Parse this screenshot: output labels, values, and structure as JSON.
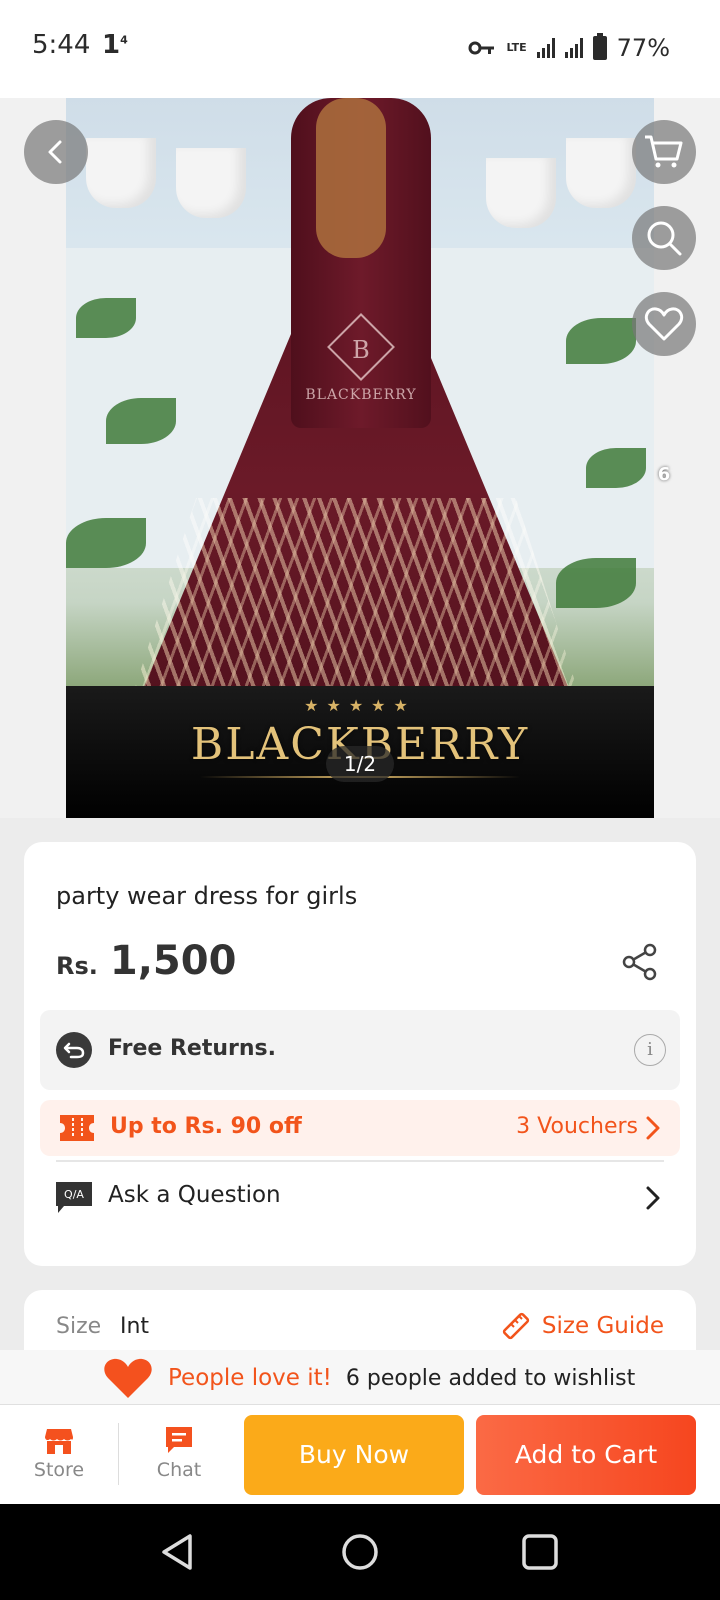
{
  "status_bar": {
    "time": "5:44",
    "indicator": "1",
    "indicator_sup": "4",
    "lte": "LTE",
    "battery_pct": "77%"
  },
  "hero": {
    "image_description": "maroon embroidered gown on model with potted plants",
    "watermark_letter": "B",
    "watermark_brand": "BLACKBERRY",
    "banner_stars": "★★★★★",
    "banner_brand": "BLACKBERRY",
    "image_counter": "1/2",
    "wishlist_count": "6"
  },
  "product": {
    "title": "party wear dress for girls",
    "currency": "Rs.",
    "price": "1,500"
  },
  "returns": {
    "label": "Free Returns.",
    "info_glyph": "i"
  },
  "voucher": {
    "label": "Up to Rs. 90 off",
    "count": "3 Vouchers"
  },
  "qa": {
    "icon_text": "Q/A",
    "label": "Ask a Question"
  },
  "size": {
    "label": "Size",
    "value": "Int",
    "guide_label": "Size Guide"
  },
  "wishlist_strip": {
    "love_text": "People love it!",
    "info_text": "6 people added to wishlist"
  },
  "action_bar": {
    "store_label": "Store",
    "chat_label": "Chat",
    "buy_now_label": "Buy Now",
    "add_to_cart_label": "Add to Cart"
  },
  "colors": {
    "accent": "#f2541b",
    "buy_now": "#fbaa19",
    "add_to_cart": "#f6461f"
  },
  "icons": [
    "back-arrow-icon",
    "cart-icon",
    "search-icon",
    "heart-icon",
    "share-icon",
    "return-icon",
    "info-icon",
    "voucher-icon",
    "chevron-right-icon",
    "qa-icon",
    "ruler-icon",
    "store-icon",
    "chat-icon",
    "nav-back-icon",
    "nav-home-icon",
    "nav-recents-icon"
  ]
}
